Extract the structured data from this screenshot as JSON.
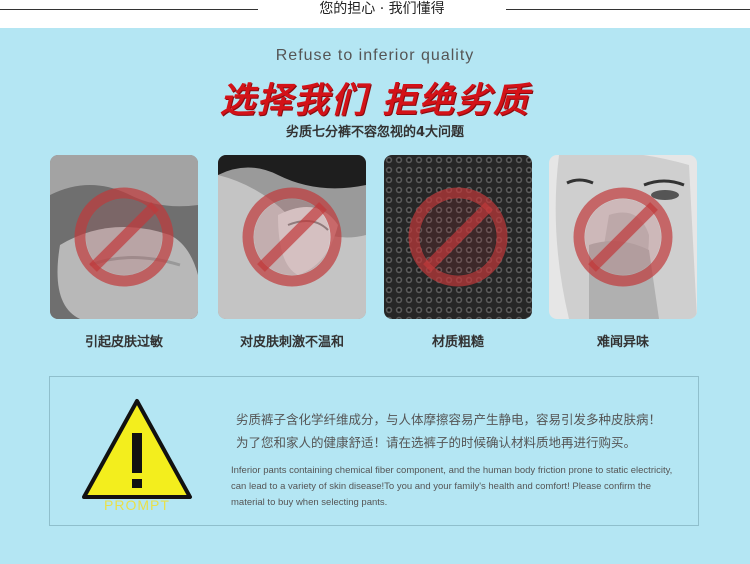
{
  "header": {
    "title": "您的担心 · 我们懂得"
  },
  "hero": {
    "english_subtitle": "Refuse  to  inferior  quality",
    "headline": "选择我们 拒绝劣质",
    "subheading": "劣质七分裤不容忽视的4大问题"
  },
  "problems": [
    {
      "label": "引起皮肤过敏",
      "icon": "prohibited-icon"
    },
    {
      "label": "对皮肤刺激不温和",
      "icon": "prohibited-icon"
    },
    {
      "label": "材质粗糙",
      "icon": "prohibited-icon"
    },
    {
      "label": "难闻异味",
      "icon": "prohibited-icon"
    }
  ],
  "prompt": {
    "badge": "PROMPT",
    "icon": "warning-triangle-icon",
    "cn_line1": "劣质裤子含化学纤维成分，与人体摩擦容易产生静电，容易引发多种皮肤病！",
    "cn_line2": "为了您和家人的健康舒适！请在选裤子的时候确认材料质地再进行购买。",
    "en_line1": "Inferior pants containing chemical fiber component, and the human body friction prone to static electricity,",
    "en_line2": " can lead to a variety of skin disease!To you and your family's health and comfort! Please confirm the",
    "en_line3": "material to buy when selecting pants."
  },
  "colors": {
    "background": "#b4e6f3",
    "headline_red": "#d31218",
    "prohibit_red": "#c0393b",
    "warning_yellow": "#f3ee1d"
  }
}
